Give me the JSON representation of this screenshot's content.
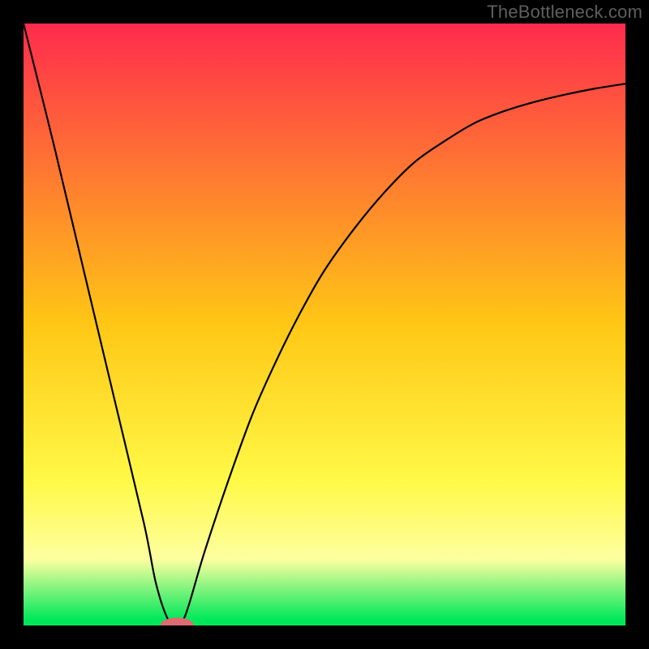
{
  "watermark": "TheBottleneck.com",
  "chart_data": {
    "type": "line",
    "title": "",
    "xlabel": "",
    "ylabel": "",
    "xlim": [
      0,
      100
    ],
    "ylim": [
      0,
      100
    ],
    "grid": false,
    "legend": false,
    "background_gradient": {
      "stops": [
        {
          "offset": 0,
          "color": "#ff2b4d"
        },
        {
          "offset": 50,
          "color": "#ffc715"
        },
        {
          "offset": 76,
          "color": "#fff947"
        },
        {
          "offset": 89,
          "color": "#fdffa0"
        },
        {
          "offset": 99,
          "color": "#00e85a"
        }
      ]
    },
    "series": [
      {
        "name": "curve",
        "x": [
          0,
          5,
          10,
          15,
          20,
          22,
          24,
          25.5,
          27,
          30,
          34,
          38,
          42,
          46,
          50,
          55,
          60,
          65,
          70,
          75,
          80,
          85,
          90,
          95,
          100
        ],
        "y": [
          100,
          80,
          59,
          38,
          17,
          7,
          1,
          0,
          2,
          12,
          24,
          35,
          44,
          52,
          59,
          66,
          72,
          77,
          80.5,
          83.5,
          85.5,
          87,
          88.2,
          89.2,
          90
        ]
      }
    ],
    "marker": {
      "x": 25.5,
      "y": 0,
      "color": "#df6a72",
      "rx_pct": 2.8,
      "ry_pct": 1.3
    }
  }
}
